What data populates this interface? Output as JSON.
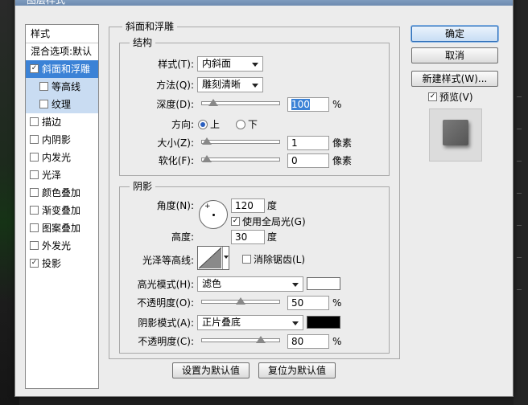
{
  "window_title": "图层样式",
  "style_list": {
    "header": "样式",
    "blend_options": "混合选项:默认",
    "items": [
      {
        "label": "斜面和浮雕",
        "checked": true
      },
      {
        "label": "等高线",
        "checked": false
      },
      {
        "label": "纹理",
        "checked": false
      },
      {
        "label": "描边",
        "checked": false
      },
      {
        "label": "内阴影",
        "checked": false
      },
      {
        "label": "内发光",
        "checked": false
      },
      {
        "label": "光泽",
        "checked": false
      },
      {
        "label": "颜色叠加",
        "checked": false
      },
      {
        "label": "渐变叠加",
        "checked": false
      },
      {
        "label": "图案叠加",
        "checked": false
      },
      {
        "label": "外发光",
        "checked": false
      },
      {
        "label": "投影",
        "checked": true
      }
    ],
    "check_mark": "✓"
  },
  "bevel": {
    "title": "斜面和浮雕",
    "structure": {
      "title": "结构",
      "style_label": "样式(T):",
      "style_value": "内斜面",
      "technique_label": "方法(Q):",
      "technique_value": "雕刻清晰",
      "depth_label": "深度(D):",
      "depth_value": "100",
      "depth_unit": "%",
      "depth_level": 0.1,
      "direction_label": "方向:",
      "direction_up": "上",
      "direction_down": "下",
      "size_label": "大小(Z):",
      "size_value": "1",
      "size_unit": "像素",
      "size_level": 0.0,
      "soften_label": "软化(F):",
      "soften_value": "0",
      "soften_unit": "像素",
      "soften_level": 0.0
    },
    "shading": {
      "title": "阴影",
      "angle_label": "角度(N):",
      "angle_value": "120",
      "angle_unit": "度",
      "global_light": "使用全局光(G)",
      "altitude_label": "高度:",
      "altitude_value": "30",
      "altitude_unit": "度",
      "gloss_label": "光泽等高线:",
      "anti_alias": "消除锯齿(L)",
      "highlight_mode_label": "高光模式(H):",
      "highlight_mode_value": "滤色",
      "highlight_color": "#ffffff",
      "highlight_opacity_label": "不透明度(O):",
      "highlight_opacity_value": "50",
      "highlight_opacity_level": 0.5,
      "shadow_mode_label": "阴影模式(A):",
      "shadow_mode_value": "正片叠底",
      "shadow_color": "#000000",
      "shadow_opacity_label": "不透明度(C):",
      "shadow_opacity_value": "80",
      "shadow_opacity_level": 0.8,
      "percent": "%"
    },
    "make_default": "设置为默认值",
    "reset_default": "复位为默认值"
  },
  "buttons": {
    "ok": "确定",
    "cancel": "取消",
    "new_style": "新建样式(W)...",
    "preview": "预览(V)"
  },
  "accent_color": "#3b82d6"
}
